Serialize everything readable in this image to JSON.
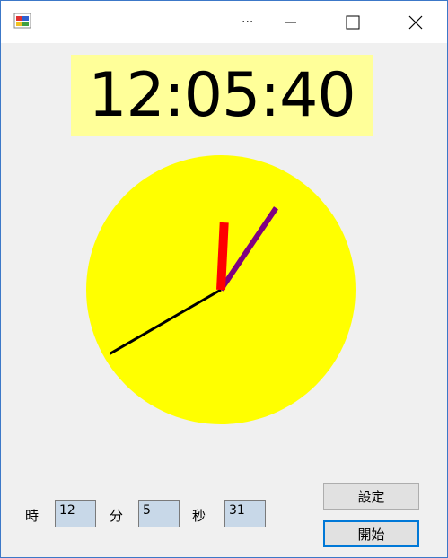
{
  "window": {
    "title": "..."
  },
  "display": {
    "time": "12:05:40"
  },
  "clock": {
    "hours": 12,
    "minutes": 5,
    "seconds": 40,
    "face_color": "#ffff00"
  },
  "inputs": {
    "hour_label": "時",
    "hour_value": "12",
    "minute_label": "分",
    "minute_value": "5",
    "second_label": "秒",
    "second_value": "31"
  },
  "buttons": {
    "set_label": "設定",
    "start_label": "開始"
  }
}
